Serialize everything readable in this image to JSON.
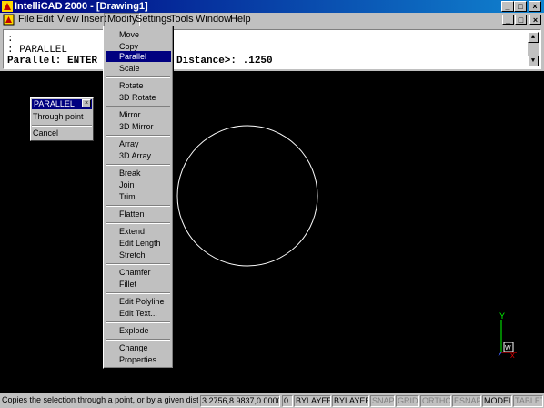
{
  "window": {
    "title": "IntelliCAD 2000 - [Drawing1]",
    "minimize_glyph": "_",
    "maximize_glyph": "□",
    "close_glyph": "×"
  },
  "menubar": {
    "items": [
      "File",
      "Edit",
      "View",
      "Insert",
      "Modify",
      "Settings",
      "Tools",
      "Window",
      "Help"
    ],
    "active": "Modify"
  },
  "command_window": {
    "lines": [
      ":",
      ": PARALLEL",
      "Parallel: ENTER for '",
      "Distance>: .1250"
    ]
  },
  "palette": {
    "title": "PARALLEL",
    "close_glyph": "×",
    "items": [
      "Through point",
      "Cancel"
    ]
  },
  "modify_menu": {
    "items": [
      "Move",
      "Copy",
      "Parallel",
      "Scale",
      "Rotate",
      "3D Rotate",
      "Mirror",
      "3D Mirror",
      "Array",
      "3D Array",
      "Break",
      "Join",
      "Trim",
      "Flatten",
      "Extend",
      "Edit Length",
      "Stretch",
      "Chamfer",
      "Fillet",
      "Edit Polyline",
      "Edit Text...",
      "Explode",
      "Change",
      "Properties..."
    ],
    "selected": "Parallel"
  },
  "ucs_icon": {
    "y_label": "Y",
    "x_label": "X",
    "w_label": "W"
  },
  "statusbar": {
    "message": "Copies the selection through a point, or by a given distance",
    "coordinates": "3.2756,8.9837,0.0000",
    "color_index": "0",
    "layer": "BYLAYER",
    "linetype": "BYLAYER",
    "snap": "SNAP",
    "grid": "GRID",
    "ortho": "ORTHO",
    "esnap": "ESNAP",
    "model": "MODEL",
    "tablet": "TABLET"
  },
  "colors": {
    "title_bar": "#000080",
    "menu_highlight": "#000080",
    "canvas": "#000000",
    "ucs_y_axis": "#00ff00",
    "ucs_x_axis": "#ff0000",
    "ucs_z_axis": "#0000ff"
  }
}
